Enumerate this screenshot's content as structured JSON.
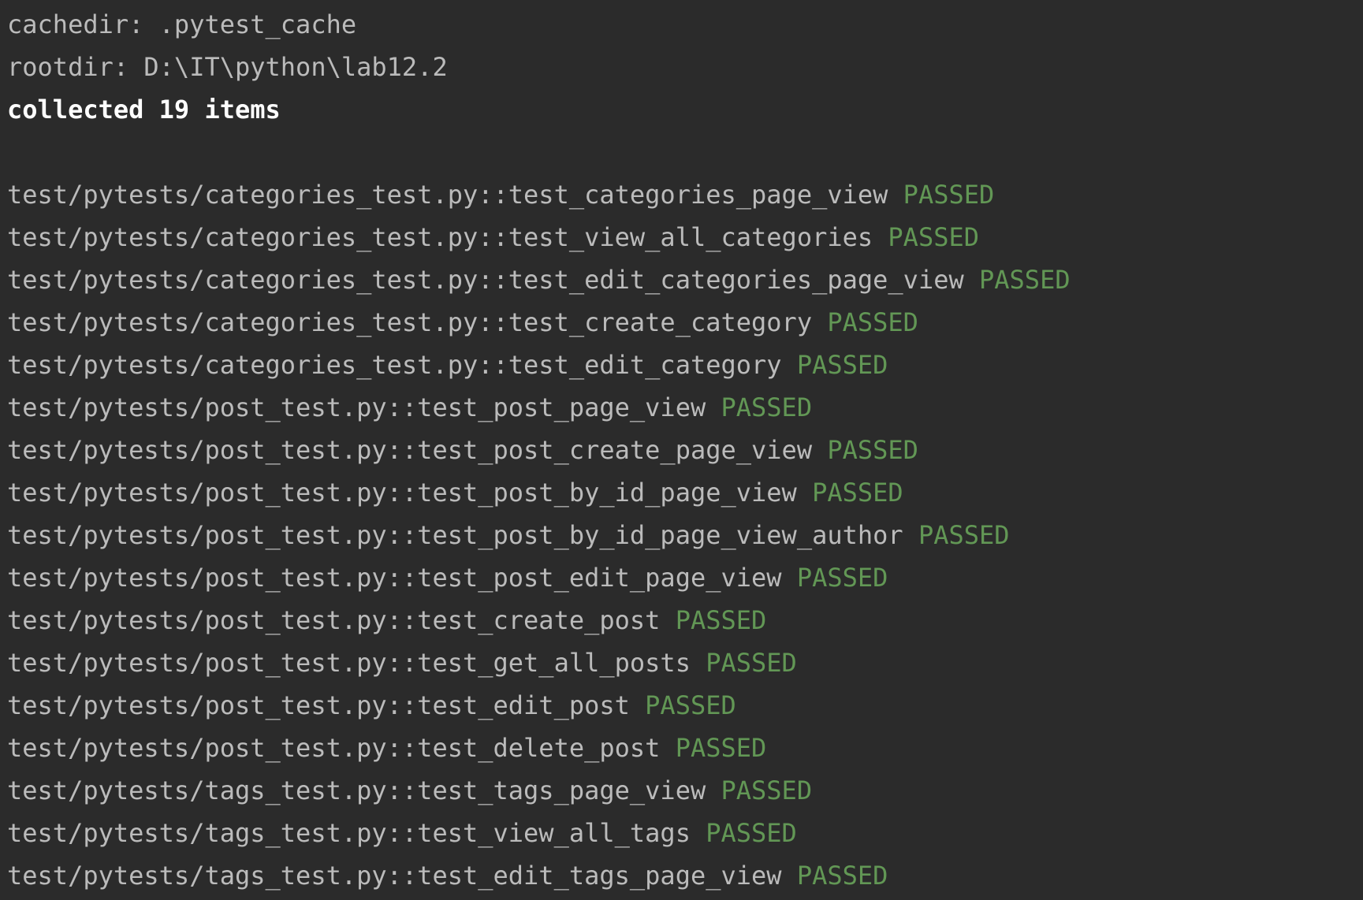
{
  "console": {
    "header": {
      "cachedir": "cachedir: .pytest_cache",
      "rootdir": "rootdir: D:\\IT\\python\\lab12.2",
      "collected": "collected 19 items"
    },
    "status_color": "#629755",
    "tests": [
      {
        "name": "test/pytests/categories_test.py::test_categories_page_view",
        "status": "PASSED"
      },
      {
        "name": "test/pytests/categories_test.py::test_view_all_categories",
        "status": "PASSED"
      },
      {
        "name": "test/pytests/categories_test.py::test_edit_categories_page_view",
        "status": "PASSED"
      },
      {
        "name": "test/pytests/categories_test.py::test_create_category",
        "status": "PASSED"
      },
      {
        "name": "test/pytests/categories_test.py::test_edit_category",
        "status": "PASSED"
      },
      {
        "name": "test/pytests/post_test.py::test_post_page_view",
        "status": "PASSED"
      },
      {
        "name": "test/pytests/post_test.py::test_post_create_page_view",
        "status": "PASSED"
      },
      {
        "name": "test/pytests/post_test.py::test_post_by_id_page_view",
        "status": "PASSED"
      },
      {
        "name": "test/pytests/post_test.py::test_post_by_id_page_view_author",
        "status": "PASSED"
      },
      {
        "name": "test/pytests/post_test.py::test_post_edit_page_view",
        "status": "PASSED"
      },
      {
        "name": "test/pytests/post_test.py::test_create_post",
        "status": "PASSED"
      },
      {
        "name": "test/pytests/post_test.py::test_get_all_posts",
        "status": "PASSED"
      },
      {
        "name": "test/pytests/post_test.py::test_edit_post",
        "status": "PASSED"
      },
      {
        "name": "test/pytests/post_test.py::test_delete_post",
        "status": "PASSED"
      },
      {
        "name": "test/pytests/tags_test.py::test_tags_page_view",
        "status": "PASSED"
      },
      {
        "name": "test/pytests/tags_test.py::test_view_all_tags",
        "status": "PASSED"
      },
      {
        "name": "test/pytests/tags_test.py::test_edit_tags_page_view",
        "status": "PASSED"
      }
    ]
  }
}
